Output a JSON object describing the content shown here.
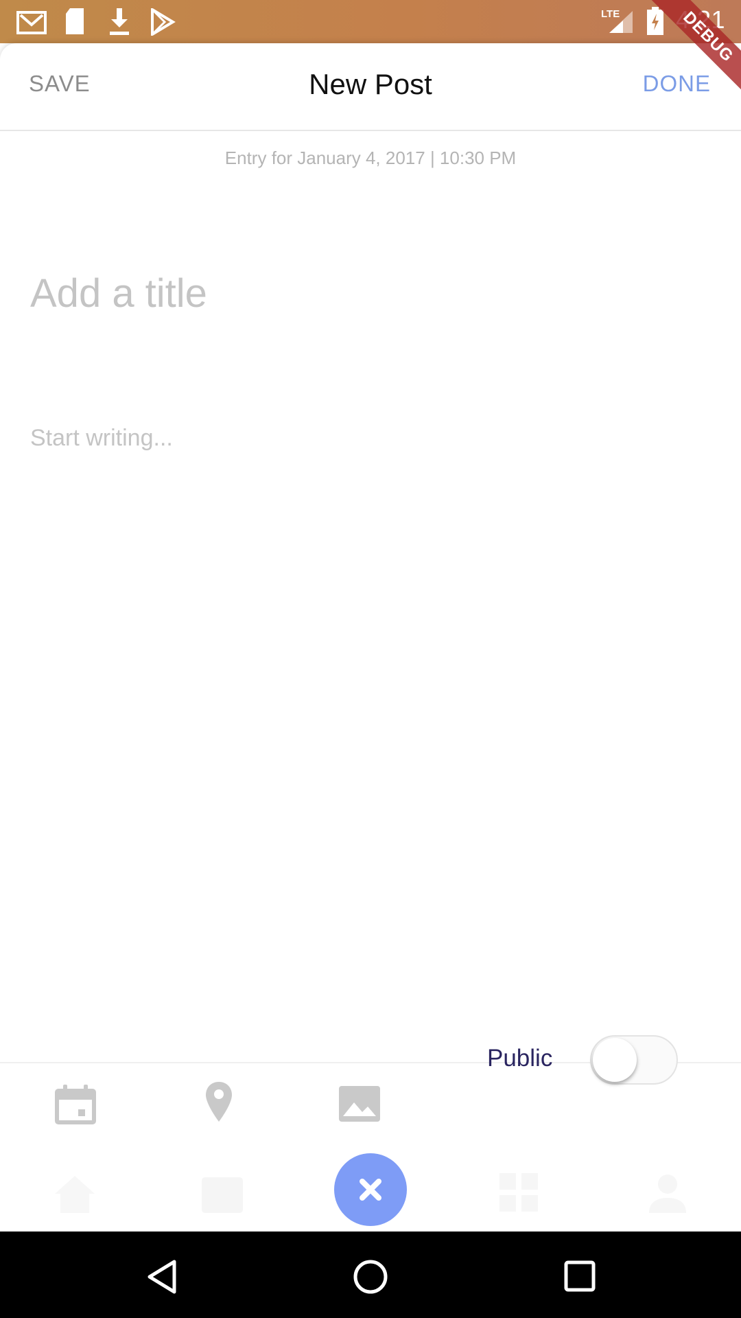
{
  "status_bar": {
    "time": "4:21",
    "network": "LTE",
    "icons": [
      "gmail-icon",
      "sd-card-icon",
      "download-icon",
      "play-store-icon",
      "signal-icon",
      "battery-charging-icon"
    ]
  },
  "debug_banner": "DEBUG",
  "header": {
    "save_label": "SAVE",
    "title": "New Post",
    "done_label": "DONE"
  },
  "entry": {
    "meta": "Entry for January 4, 2017 | 10:30 PM",
    "title_placeholder": "Add a title",
    "body_placeholder": "Start writing..."
  },
  "toolbar": {
    "public_label": "Public",
    "public_enabled": false,
    "tools": [
      "calendar-icon",
      "location-pin-icon",
      "image-icon"
    ]
  },
  "bottom_nav": {
    "items": [
      "home-icon",
      "calendar-icon",
      "close-icon",
      "grid-icon",
      "person-icon"
    ]
  },
  "colors": {
    "accent": "#7b9ce6",
    "fab": "#7e9cf6",
    "public_text": "#2a2560"
  }
}
